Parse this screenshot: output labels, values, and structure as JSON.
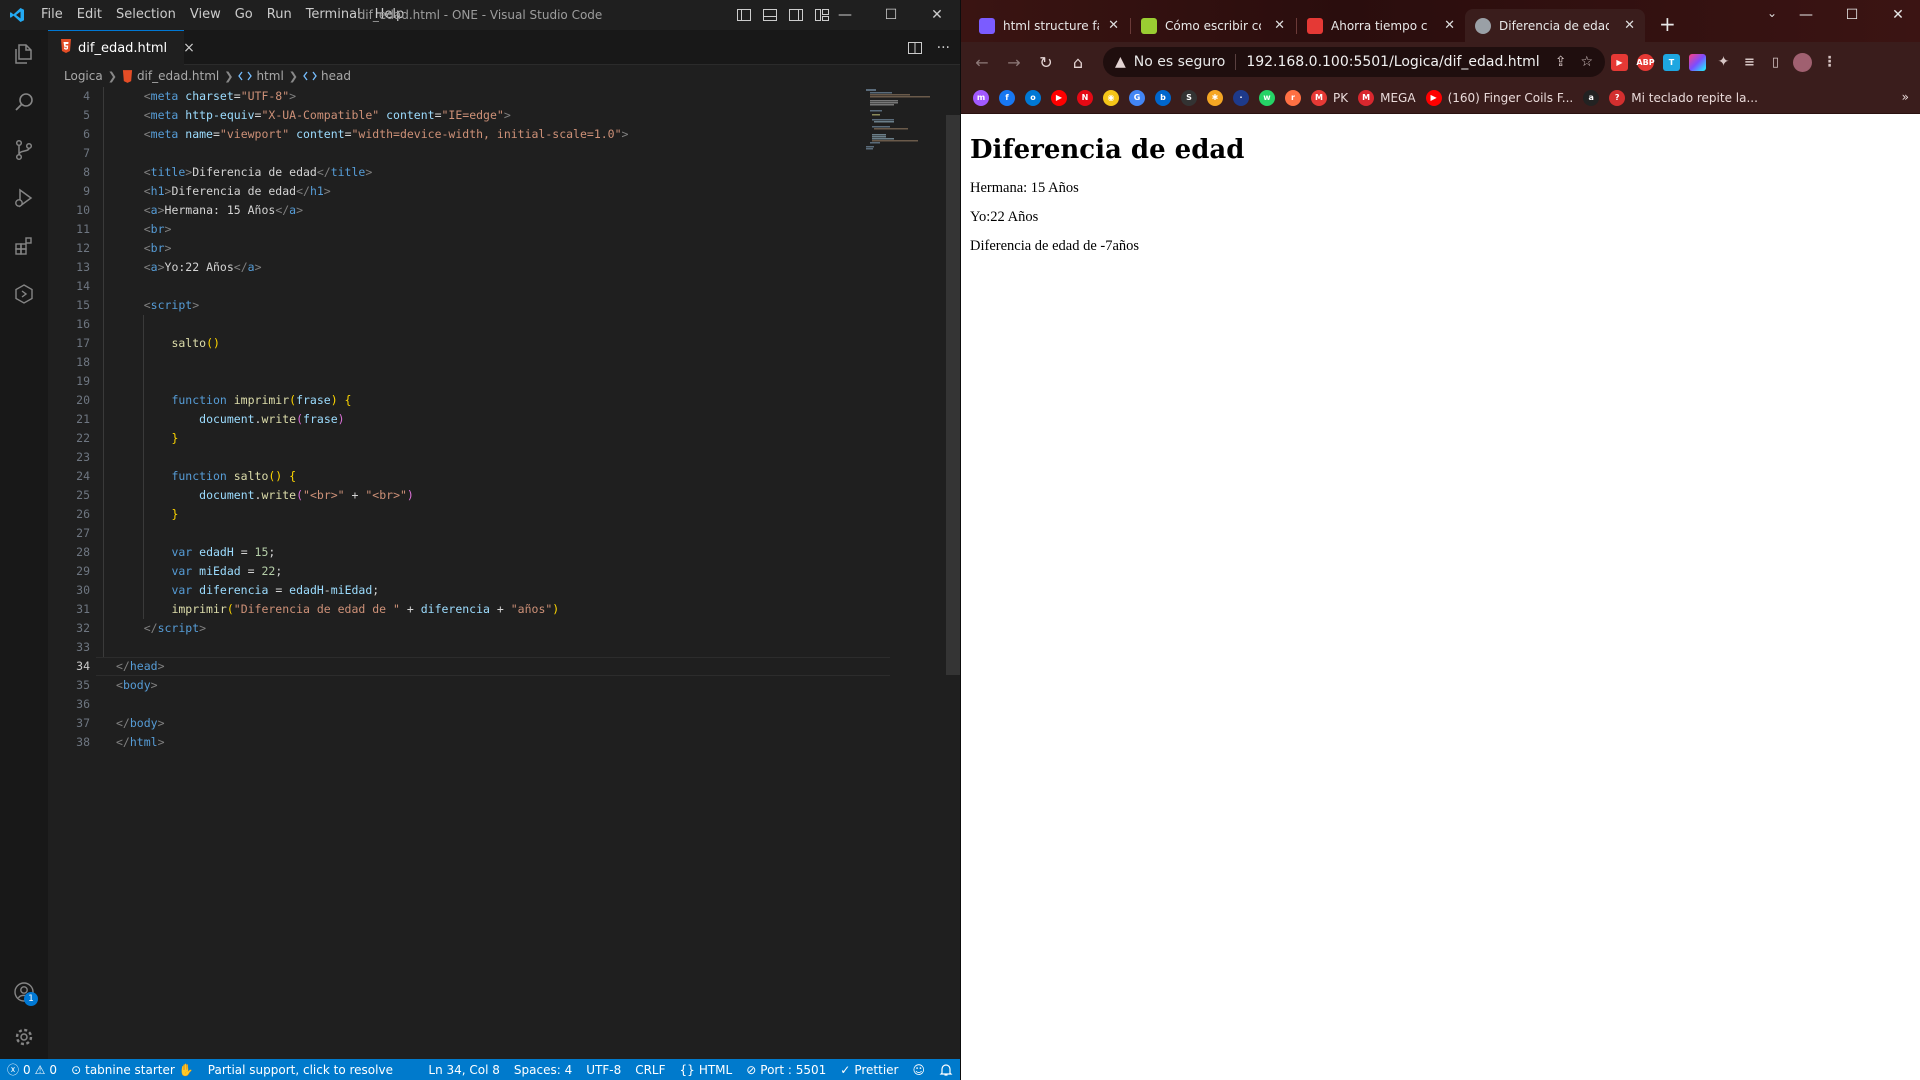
{
  "vscode": {
    "menu": [
      "File",
      "Edit",
      "Selection",
      "View",
      "Go",
      "Run",
      "Terminal",
      "Help"
    ],
    "window_title": "dif_edad.html - ONE - Visual Studio Code",
    "tab": {
      "filename": "dif_edad.html",
      "close": "×"
    },
    "breadcrumb": [
      "Logica",
      "dif_edad.html",
      "html",
      "head"
    ],
    "activity_badge": "1",
    "current_line": 34,
    "code_lines": [
      {
        "n": 4,
        "indent": 2,
        "tokens": [
          [
            "t-tag",
            "<"
          ],
          [
            "t-name",
            "meta "
          ],
          [
            "t-attr",
            "charset"
          ],
          [
            "t-pl",
            "="
          ],
          [
            "t-str",
            "\"UTF-8\""
          ],
          [
            "t-tag",
            ">"
          ]
        ]
      },
      {
        "n": 5,
        "indent": 2,
        "tokens": [
          [
            "t-tag",
            "<"
          ],
          [
            "t-name",
            "meta "
          ],
          [
            "t-attr",
            "http-equiv"
          ],
          [
            "t-pl",
            "="
          ],
          [
            "t-str",
            "\"X-UA-Compatible\" "
          ],
          [
            "t-attr",
            "content"
          ],
          [
            "t-pl",
            "="
          ],
          [
            "t-str",
            "\"IE=edge\""
          ],
          [
            "t-tag",
            ">"
          ]
        ]
      },
      {
        "n": 6,
        "indent": 2,
        "tokens": [
          [
            "t-tag",
            "<"
          ],
          [
            "t-name",
            "meta "
          ],
          [
            "t-attr",
            "name"
          ],
          [
            "t-pl",
            "="
          ],
          [
            "t-str",
            "\"viewport\" "
          ],
          [
            "t-attr",
            "content"
          ],
          [
            "t-pl",
            "="
          ],
          [
            "t-str",
            "\"width=device-width, initial-scale=1.0\""
          ],
          [
            "t-tag",
            ">"
          ]
        ]
      },
      {
        "n": 7,
        "indent": 0,
        "tokens": []
      },
      {
        "n": 8,
        "indent": 2,
        "tokens": [
          [
            "t-tag",
            "<"
          ],
          [
            "t-name",
            "title"
          ],
          [
            "t-tag",
            ">"
          ],
          [
            "t-text",
            "Diferencia de edad"
          ],
          [
            "t-tag",
            "</"
          ],
          [
            "t-name",
            "title"
          ],
          [
            "t-tag",
            ">"
          ]
        ]
      },
      {
        "n": 9,
        "indent": 2,
        "tokens": [
          [
            "t-tag",
            "<"
          ],
          [
            "t-name",
            "h1"
          ],
          [
            "t-tag",
            ">"
          ],
          [
            "t-text",
            "Diferencia de edad"
          ],
          [
            "t-tag",
            "</"
          ],
          [
            "t-name",
            "h1"
          ],
          [
            "t-tag",
            ">"
          ]
        ]
      },
      {
        "n": 10,
        "indent": 2,
        "tokens": [
          [
            "t-tag",
            "<"
          ],
          [
            "t-name",
            "a"
          ],
          [
            "t-tag",
            ">"
          ],
          [
            "t-text",
            "Hermana: 15 Años"
          ],
          [
            "t-tag",
            "</"
          ],
          [
            "t-name",
            "a"
          ],
          [
            "t-tag",
            ">"
          ]
        ]
      },
      {
        "n": 11,
        "indent": 2,
        "tokens": [
          [
            "t-tag",
            "<"
          ],
          [
            "t-name",
            "br"
          ],
          [
            "t-tag",
            ">"
          ]
        ]
      },
      {
        "n": 12,
        "indent": 2,
        "tokens": [
          [
            "t-tag",
            "<"
          ],
          [
            "t-name",
            "br"
          ],
          [
            "t-tag",
            ">"
          ]
        ]
      },
      {
        "n": 13,
        "indent": 2,
        "tokens": [
          [
            "t-tag",
            "<"
          ],
          [
            "t-name",
            "a"
          ],
          [
            "t-tag",
            ">"
          ],
          [
            "t-text",
            "Yo:22 Años"
          ],
          [
            "t-tag",
            "</"
          ],
          [
            "t-name",
            "a"
          ],
          [
            "t-tag",
            ">"
          ]
        ]
      },
      {
        "n": 14,
        "indent": 0,
        "tokens": []
      },
      {
        "n": 15,
        "indent": 2,
        "tokens": [
          [
            "t-tag",
            "<"
          ],
          [
            "t-name",
            "script"
          ],
          [
            "t-tag",
            ">"
          ]
        ]
      },
      {
        "n": 16,
        "indent": 0,
        "tokens": []
      },
      {
        "n": 17,
        "indent": 3,
        "tokens": [
          [
            "t-fn",
            "salto"
          ],
          [
            "t-br1",
            "()"
          ]
        ]
      },
      {
        "n": 18,
        "indent": 0,
        "tokens": []
      },
      {
        "n": 19,
        "indent": 0,
        "tokens": []
      },
      {
        "n": 20,
        "indent": 3,
        "tokens": [
          [
            "t-kw",
            "function "
          ],
          [
            "t-fn",
            "imprimir"
          ],
          [
            "t-br1",
            "("
          ],
          [
            "t-var",
            "frase"
          ],
          [
            "t-br1",
            ") {"
          ]
        ]
      },
      {
        "n": 21,
        "indent": 4,
        "tokens": [
          [
            "t-var",
            "document"
          ],
          [
            "t-pl",
            "."
          ],
          [
            "t-fn",
            "write"
          ],
          [
            "t-br2",
            "("
          ],
          [
            "t-var",
            "frase"
          ],
          [
            "t-br2",
            ")"
          ]
        ]
      },
      {
        "n": 22,
        "indent": 3,
        "tokens": [
          [
            "t-br1",
            "}"
          ]
        ]
      },
      {
        "n": 23,
        "indent": 0,
        "tokens": []
      },
      {
        "n": 24,
        "indent": 3,
        "tokens": [
          [
            "t-kw",
            "function "
          ],
          [
            "t-fn",
            "salto"
          ],
          [
            "t-br1",
            "() {"
          ]
        ]
      },
      {
        "n": 25,
        "indent": 4,
        "tokens": [
          [
            "t-var",
            "document"
          ],
          [
            "t-pl",
            "."
          ],
          [
            "t-fn",
            "write"
          ],
          [
            "t-br2",
            "("
          ],
          [
            "t-str",
            "\"<br>\""
          ],
          [
            "t-pl",
            " + "
          ],
          [
            "t-str",
            "\"<br>\""
          ],
          [
            "t-br2",
            ")"
          ]
        ]
      },
      {
        "n": 26,
        "indent": 3,
        "tokens": [
          [
            "t-br1",
            "}"
          ]
        ]
      },
      {
        "n": 27,
        "indent": 0,
        "tokens": []
      },
      {
        "n": 28,
        "indent": 3,
        "tokens": [
          [
            "t-kw",
            "var "
          ],
          [
            "t-var",
            "edadH"
          ],
          [
            "t-pl",
            " = "
          ],
          [
            "t-num",
            "15"
          ],
          [
            "t-pl",
            ";"
          ]
        ]
      },
      {
        "n": 29,
        "indent": 3,
        "tokens": [
          [
            "t-kw",
            "var "
          ],
          [
            "t-var",
            "miEdad"
          ],
          [
            "t-pl",
            " = "
          ],
          [
            "t-num",
            "22"
          ],
          [
            "t-pl",
            ";"
          ]
        ]
      },
      {
        "n": 30,
        "indent": 3,
        "tokens": [
          [
            "t-kw",
            "var "
          ],
          [
            "t-var",
            "diferencia"
          ],
          [
            "t-pl",
            " = "
          ],
          [
            "t-var",
            "edadH"
          ],
          [
            "t-pl",
            "-"
          ],
          [
            "t-var",
            "miEdad"
          ],
          [
            "t-pl",
            ";"
          ]
        ]
      },
      {
        "n": 31,
        "indent": 3,
        "tokens": [
          [
            "t-fn",
            "imprimir"
          ],
          [
            "t-br1",
            "("
          ],
          [
            "t-str",
            "\"Diferencia de edad de \""
          ],
          [
            "t-pl",
            " + "
          ],
          [
            "t-var",
            "diferencia"
          ],
          [
            "t-pl",
            " + "
          ],
          [
            "t-str",
            "\"años\""
          ],
          [
            "t-br1",
            ")"
          ]
        ]
      },
      {
        "n": 32,
        "indent": 2,
        "tokens": [
          [
            "t-tag",
            "</"
          ],
          [
            "t-name",
            "script"
          ],
          [
            "t-tag",
            ">"
          ]
        ]
      },
      {
        "n": 33,
        "indent": 0,
        "tokens": []
      },
      {
        "n": 34,
        "indent": 1,
        "tokens": [
          [
            "t-tag",
            "</"
          ],
          [
            "t-name",
            "head"
          ],
          [
            "t-tag",
            ">"
          ]
        ]
      },
      {
        "n": 35,
        "indent": 1,
        "tokens": [
          [
            "t-tag",
            "<"
          ],
          [
            "t-name",
            "body"
          ],
          [
            "t-tag",
            ">"
          ]
        ]
      },
      {
        "n": 36,
        "indent": 0,
        "tokens": []
      },
      {
        "n": 37,
        "indent": 1,
        "tokens": [
          [
            "t-tag",
            "</"
          ],
          [
            "t-name",
            "body"
          ],
          [
            "t-tag",
            ">"
          ]
        ]
      },
      {
        "n": 38,
        "indent": 1,
        "tokens": [
          [
            "t-tag",
            "</"
          ],
          [
            "t-name",
            "html"
          ],
          [
            "t-tag",
            ">"
          ]
        ]
      }
    ],
    "status": {
      "errors": "0",
      "warnings": "0",
      "tabnine": "tabnine starter",
      "partial": "Partial support, click to resolve",
      "position": "Ln 34, Col 8",
      "spaces": "Spaces: 4",
      "encoding": "UTF-8",
      "eol": "CRLF",
      "language": "HTML",
      "port": "Port : 5501",
      "prettier": "Prettier"
    }
  },
  "chrome": {
    "tabs": [
      {
        "title": "html structure fast",
        "icon_color": "#7b5cff"
      },
      {
        "title": "Cómo escribir códig",
        "icon_color": "#9acd32"
      },
      {
        "title": "Ahorra tiempo con",
        "icon_color": "#e53935"
      },
      {
        "title": "Diferencia de edad",
        "icon_color": "#9aa0a6",
        "active": true
      }
    ],
    "new_tab": "+",
    "omnibox": {
      "security_text": "No es seguro",
      "url": "192.168.0.100:5501/Logica/dif_edad.html"
    },
    "bookmarks": [
      {
        "label": "",
        "color": "#a259ff",
        "glyph": "m"
      },
      {
        "label": "",
        "color": "#1877f2",
        "glyph": "f"
      },
      {
        "label": "",
        "color": "#0078d4",
        "glyph": "o"
      },
      {
        "label": "",
        "color": "#ff0000",
        "glyph": "▶"
      },
      {
        "label": "",
        "color": "#e50914",
        "glyph": "N"
      },
      {
        "label": "",
        "color": "#f5c518",
        "glyph": "◉"
      },
      {
        "label": "",
        "color": "#4285f4",
        "glyph": "G"
      },
      {
        "label": "",
        "color": "#0066cc",
        "glyph": "b"
      },
      {
        "label": "",
        "color": "#333333",
        "glyph": "S"
      },
      {
        "label": "",
        "color": "#f5a623",
        "glyph": "✱"
      },
      {
        "label": "",
        "color": "#1e3a8a",
        "glyph": "·"
      },
      {
        "label": "",
        "color": "#25d366",
        "glyph": "w"
      },
      {
        "label": "",
        "color": "#ff7043",
        "glyph": "r"
      },
      {
        "label": "PK",
        "color": "#e53935",
        "glyph": "M"
      },
      {
        "label": "MEGA",
        "color": "#d9272e",
        "glyph": "M"
      },
      {
        "label": "(160) Finger Coils F...",
        "color": "#ff0000",
        "glyph": "▶"
      },
      {
        "label": "",
        "color": "#222222",
        "glyph": "a"
      },
      {
        "label": "Mi teclado repite la...",
        "color": "#d32f2f",
        "glyph": "?"
      }
    ],
    "bookmarks_more": "»",
    "page": {
      "h1": "Diferencia de edad",
      "line1": "Hermana: 15 Años",
      "line2": "Yo:22 Años",
      "line3": "Diferencia de edad de -7años"
    }
  }
}
